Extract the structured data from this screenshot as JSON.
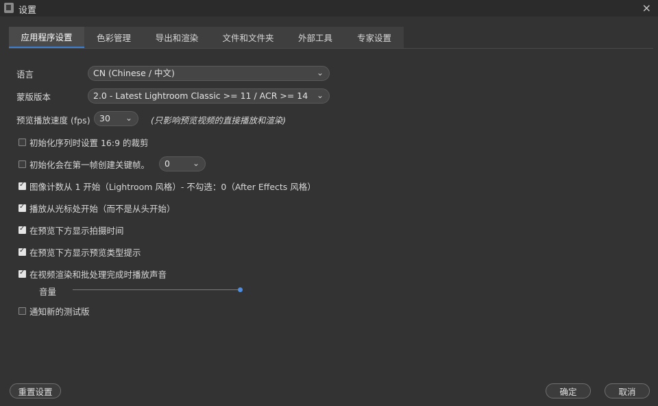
{
  "window": {
    "title": "设置",
    "close_icon": "×"
  },
  "tabs": [
    {
      "label": "应用程序设置",
      "active": true
    },
    {
      "label": "色彩管理"
    },
    {
      "label": "导出和渲染"
    },
    {
      "label": "文件和文件夹"
    },
    {
      "label": "外部工具"
    },
    {
      "label": "专家设置"
    }
  ],
  "settings": {
    "language": {
      "label": "语言",
      "value": "CN (Chinese / 中文)"
    },
    "mask_version": {
      "label": "蒙版版本",
      "value": "2.0 - Latest Lightroom Classic >= 11 / ACR >= 14"
    },
    "preview_speed": {
      "label": "预览播放速度 (fps)",
      "value": "30",
      "note": "(只影响预览视频的直接播放和渲染)"
    },
    "keyframe_value": "0"
  },
  "checkboxes": [
    {
      "label": "初始化序列时设置 16:9 的裁剪",
      "checked": false
    },
    {
      "label": "初始化会在第一帧创建关键帧。",
      "checked": false
    },
    {
      "label": "图像计数从 1 开始（Lightroom 风格）- 不勾选：0（After Effects 风格）",
      "checked": true
    },
    {
      "label": "播放从光标处开始（而不是从头开始）",
      "checked": true
    },
    {
      "label": "在预览下方显示拍摄时间",
      "checked": true
    },
    {
      "label": "在预览下方显示预览类型提示",
      "checked": true
    },
    {
      "label": "在视频渲染和批处理完成时播放声音",
      "checked": true
    },
    {
      "label": "通知新的测试版",
      "checked": false
    }
  ],
  "volume": {
    "label": "音量",
    "level": 1.0
  },
  "buttons": {
    "reset": "重置设置",
    "ok": "确定",
    "cancel": "取消"
  },
  "colors": {
    "accent": "#3f7fd0",
    "knob": "#4e8de0",
    "background": "#333333"
  }
}
